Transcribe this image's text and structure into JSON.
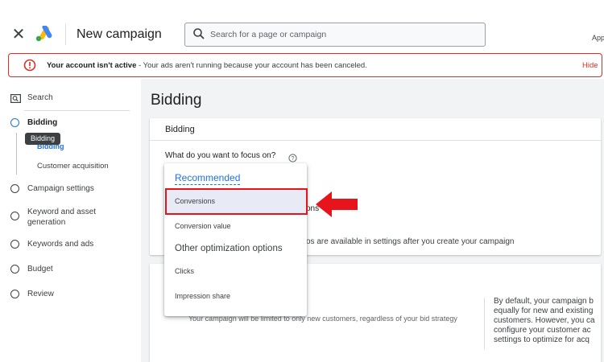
{
  "header": {
    "title": "New campaign",
    "search_placeholder": "Search for a page or campaign",
    "apps_label_partial": "App",
    "icons": {
      "close": "close-icon",
      "logo": "google-ads-logo",
      "search": "search-icon"
    }
  },
  "alert": {
    "bold": "Your account isn't active",
    "message": " - Your ads aren't running because your account has been canceled.",
    "hide": "Hide"
  },
  "sidebar": {
    "items": [
      {
        "label": "Search"
      },
      {
        "label": "Bidding"
      },
      {
        "label": "Bidding"
      },
      {
        "label": "Customer acquisition"
      },
      {
        "label": "Campaign settings"
      },
      {
        "label": "Keyword and asset generation"
      },
      {
        "label": "Keywords and ads"
      },
      {
        "label": "Budget"
      },
      {
        "label": "Review"
      }
    ],
    "tooltip": "Bidding"
  },
  "main": {
    "heading": "Bidding",
    "card_title": "Bidding",
    "focus_question": "What do you want to focus on?",
    "peek_text_1": "ons",
    "peek_text_2": "os are available in settings after you create your campaign",
    "limit_text": "Your campaign will be limited to only new customers, regardless of your bid strategy",
    "side_text": [
      "By default, your campaign b",
      "equally for new and existing",
      "customers. However, you ca",
      "configure your customer ac",
      "settings to optimize for acq"
    ]
  },
  "dropdown": {
    "recommended_header": "Recommended",
    "options_recommended": [
      "Conversions",
      "Conversion value"
    ],
    "other_header": "Other optimization options",
    "options_other": [
      "Clicks",
      "Impression share"
    ],
    "highlighted": "Conversions"
  },
  "colors": {
    "accent": "#1a73e8",
    "alert": "#d93025",
    "annotation": "#e8141b",
    "selected_bg": "#e8eaf6"
  }
}
